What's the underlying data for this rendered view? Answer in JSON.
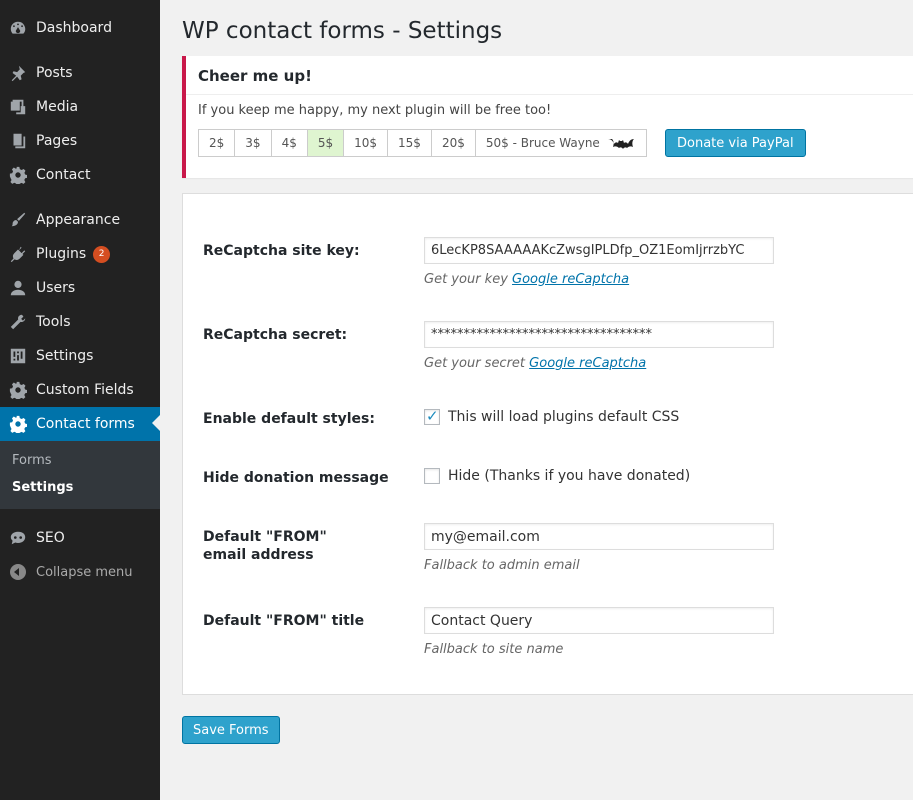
{
  "sidebar": {
    "items": [
      {
        "label": "Dashboard",
        "icon": "dashboard-icon"
      },
      {
        "label": "Posts",
        "icon": "pin-icon"
      },
      {
        "label": "Media",
        "icon": "media-icon"
      },
      {
        "label": "Pages",
        "icon": "pages-icon"
      },
      {
        "label": "Contact",
        "icon": "gear-icon"
      },
      {
        "label": "Appearance",
        "icon": "brush-icon"
      },
      {
        "label": "Plugins",
        "icon": "plug-icon",
        "badge": "2"
      },
      {
        "label": "Users",
        "icon": "user-icon"
      },
      {
        "label": "Tools",
        "icon": "wrench-icon"
      },
      {
        "label": "Settings",
        "icon": "sliders-icon"
      },
      {
        "label": "Custom Fields",
        "icon": "gear-icon"
      },
      {
        "label": "Contact forms",
        "icon": "gear-icon",
        "active": true
      },
      {
        "label": "SEO",
        "icon": "seo-icon"
      }
    ],
    "submenu": [
      {
        "label": "Forms"
      },
      {
        "label": "Settings",
        "current": true
      }
    ],
    "collapse_label": "Collapse menu",
    "accent_color": "#0073aa"
  },
  "page": {
    "title": "WP contact forms - Settings"
  },
  "donate": {
    "title": "Cheer me up!",
    "text": "If you keep me happy, my next plugin will be free too!",
    "amounts": [
      "2$",
      "3$",
      "4$",
      "5$",
      "10$",
      "15$",
      "20$",
      "50$ - Bruce Wayne"
    ],
    "selected_amount": "5$",
    "button_label": "Donate via PayPal",
    "border_color": "#c9184a"
  },
  "settings": {
    "site_key_label": "ReCaptcha site key:",
    "site_key_value": "6LecKP8SAAAAAKcZwsgIPLDfp_OZ1EomIjrrzbYC",
    "site_key_desc": "Get your key",
    "site_key_link": "Google reCaptcha",
    "secret_label": "ReCaptcha secret:",
    "secret_value": "**********************************",
    "secret_desc": "Get your secret",
    "secret_link": "Google reCaptcha",
    "styles_label": "Enable default styles:",
    "styles_text": "This will load plugins default CSS",
    "styles_checked": true,
    "hide_label": "Hide donation message",
    "hide_text": "Hide (Thanks if you have donated)",
    "hide_checked": false,
    "from_email_label": "Default \"FROM\" email address",
    "from_email_value": "my@email.com",
    "from_email_desc": "Fallback to admin email",
    "from_title_label": "Default \"FROM\" title",
    "from_title_value": "Contact Query",
    "from_title_desc": "Fallback to site name"
  },
  "save_label": "Save Forms"
}
